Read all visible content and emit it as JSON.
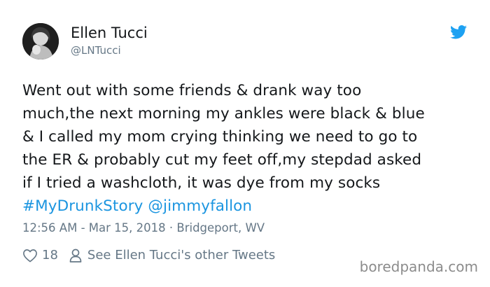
{
  "author": {
    "name": "Ellen Tucci",
    "handle": "@LNTucci"
  },
  "tweet": {
    "text_lines": [
      "Went out with some friends  & drank way too",
      "much,the next morning my ankles were black & blue",
      "& I called my mom crying thinking we need to go to",
      "the ER & probably cut my feet off,my stepdad asked",
      "if I tried a washcloth, it was dye from my socks"
    ],
    "hashtag": "#MyDrunkStory",
    "mention": "@jimmyfallon"
  },
  "meta": {
    "time": "12:56 AM",
    "date": "Mar 15, 2018",
    "location": "Bridgeport, WV"
  },
  "actions": {
    "like_count": "18",
    "other_tweets_label": "See Ellen Tucci's other Tweets"
  },
  "watermark": "boredpanda.com",
  "colors": {
    "link": "#1b95e0",
    "muted": "#657786",
    "text": "#14171a",
    "twitter_blue": "#1da1f2"
  },
  "icons": [
    "avatar",
    "twitter-bird-icon",
    "heart-icon",
    "user-icon"
  ]
}
